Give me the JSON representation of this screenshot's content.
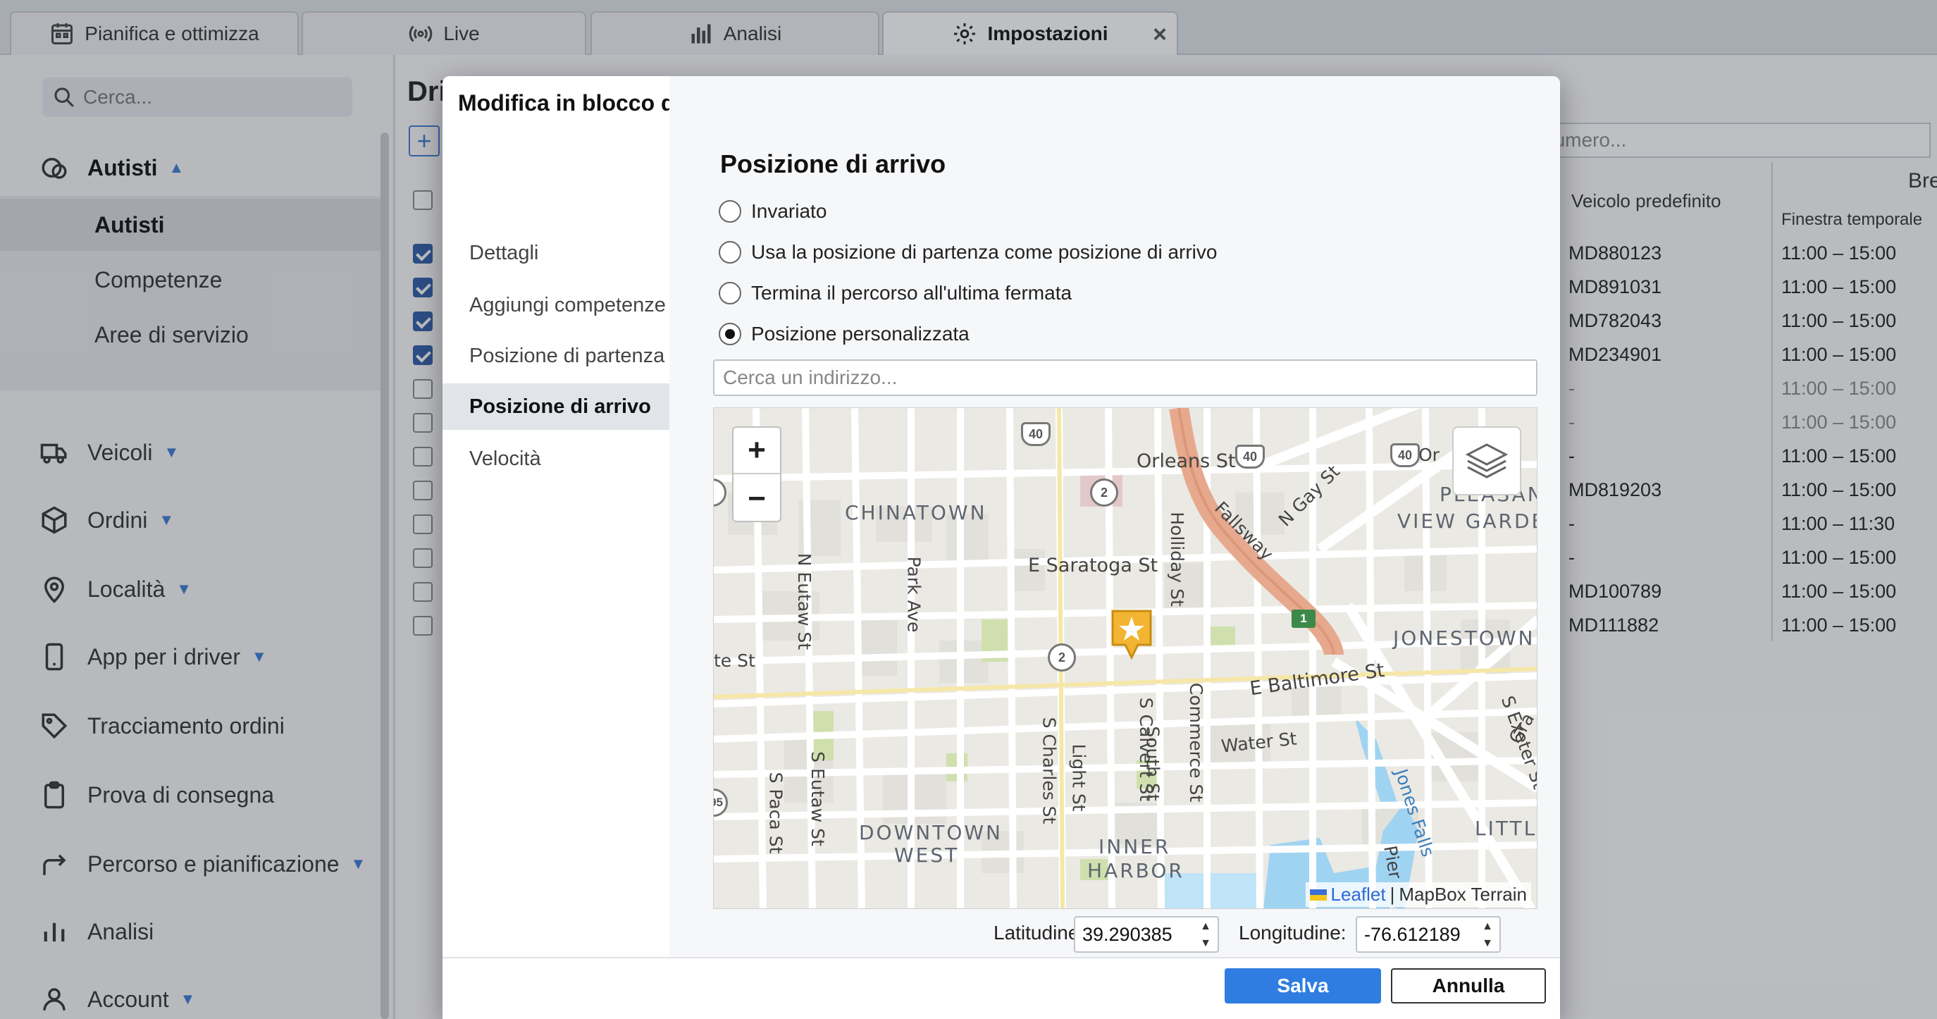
{
  "tabs": [
    {
      "label": "Pianifica e ottimizza",
      "icon": "calendar-icon"
    },
    {
      "label": "Live",
      "icon": "broadcast-icon"
    },
    {
      "label": "Analisi",
      "icon": "bar-chart-icon"
    },
    {
      "label": "Impostazioni",
      "icon": "gear-icon",
      "close": "×"
    }
  ],
  "sidebar": {
    "search_placeholder": "Cerca...",
    "autisti": {
      "label": "Autisti",
      "caret": "▲"
    },
    "sub_items": [
      "Autisti",
      "Competenze",
      "Aree di servizio"
    ],
    "items": [
      {
        "label": "Veicoli",
        "icon": "truck-icon",
        "caret": "▼"
      },
      {
        "label": "Ordini",
        "icon": "box-icon",
        "caret": "▼"
      },
      {
        "label": "Località",
        "icon": "location-pin-icon",
        "caret": "▼"
      },
      {
        "label": "App per i driver",
        "icon": "mobile-icon",
        "caret": "▼"
      },
      {
        "label": "Tracciamento ordini",
        "icon": "tag-icon",
        "caret": ""
      },
      {
        "label": "Prova di consegna",
        "icon": "clipboard-icon",
        "caret": ""
      },
      {
        "label": "Percorso e pianificazione",
        "icon": "route-arrow-icon",
        "caret": "▼"
      },
      {
        "label": "Analisi",
        "icon": "bar-chart-icon",
        "caret": ""
      },
      {
        "label": "Account",
        "icon": "user-icon",
        "caret": "▼"
      }
    ]
  },
  "background": {
    "title": "Dri",
    "add": "+",
    "search_placeholder": "i numero...",
    "col_vehicle": "Veicolo predefinito",
    "col_break": "Bre",
    "col_window": "Finestra temporale",
    "rows": [
      {
        "checked": true,
        "vehicle": "MD880123",
        "window": "11:00 – 15:00"
      },
      {
        "checked": true,
        "vehicle": "MD891031",
        "window": "11:00 – 15:00"
      },
      {
        "checked": true,
        "vehicle": "MD782043",
        "window": "11:00 – 15:00"
      },
      {
        "checked": true,
        "vehicle": "MD234901",
        "window": "11:00 – 15:00"
      },
      {
        "checked": false,
        "vehicle": "-",
        "window": "11:00 – 15:00",
        "dim": true
      },
      {
        "checked": false,
        "vehicle": "-",
        "window": "11:00 – 15:00",
        "dim": true
      },
      {
        "checked": false,
        "vehicle": "-",
        "window": "11:00 – 15:00"
      },
      {
        "checked": false,
        "vehicle": "MD819203",
        "window": "11:00 – 15:00"
      },
      {
        "checked": false,
        "vehicle": "-",
        "window": "11:00 – 11:30"
      },
      {
        "checked": false,
        "vehicle": "-",
        "window": "11:00 – 15:00"
      },
      {
        "checked": false,
        "vehicle": "MD100789",
        "window": "11:00 – 15:00"
      },
      {
        "checked": false,
        "vehicle": "MD111882",
        "window": "11:00 – 15:00"
      }
    ]
  },
  "modal": {
    "title": "Modifica in blocco dei driver",
    "nav": [
      "Dettagli",
      "Aggiungi competenze",
      "Posizione di partenza",
      "Posizione di arrivo",
      "Velocità"
    ],
    "active_nav": "Posizione di arrivo",
    "section_title": "Posizione di arrivo",
    "options": [
      {
        "label": "Invariato",
        "selected": false
      },
      {
        "label": "Usa la posizione di partenza come posizione di arrivo",
        "selected": false
      },
      {
        "label": "Termina il percorso all'ultima fermata",
        "selected": false
      },
      {
        "label": "Posizione personalizzata",
        "selected": true
      }
    ],
    "address_placeholder": "Cerca un indirizzo...",
    "map": {
      "zoom_in": "+",
      "zoom_out": "−",
      "attribution_leaflet": "Leaflet",
      "attribution_sep": "|",
      "attribution_tiles": "MapBox Terrain",
      "labels": {
        "chinatown": "CHINATOWN",
        "orleans": "Orleans St",
        "pleasant_1": "PLEASANT",
        "pleasant_2": "VIEW GARDENS",
        "fallsway": "Fallsway",
        "n_gay": "N Gay St",
        "saratoga": "E Saratoga St",
        "holliday": "Holliday St",
        "n_eutaw": "N Eutaw St",
        "park_ave": "Park Ave",
        "jonestown": "JONESTOWN",
        "baltimore": "E Baltimore St",
        "water": "Water St",
        "s_calvert": "S Calvert St",
        "commerce": "Commerce St",
        "south_st": "South St",
        "light_st": "Light St",
        "s_charles": "S Charles St",
        "s_eutaw": "S Eutaw St",
        "s_paca": "S Paca St",
        "downtown_1": "DOWNTOWN",
        "downtown_2": "WEST",
        "inner_1": "INNER",
        "inner_2": "HARBOR",
        "little": "LITTLE I",
        "exeter": "S Exeter St",
        "gra": "Gra",
        "jones_falls": "Jones Falls",
        "pier": "Pier",
        "te_st": "te St",
        "or": "Or",
        "shield_40": "40",
        "route_2": "2",
        "route_1": "1",
        "route_95": "95"
      }
    },
    "lat_label": "Latitudine:",
    "lat_value": "39.290385",
    "lng_label": "Longitudine:",
    "lng_value": "-76.612189",
    "save": "Salva",
    "cancel": "Annulla"
  }
}
